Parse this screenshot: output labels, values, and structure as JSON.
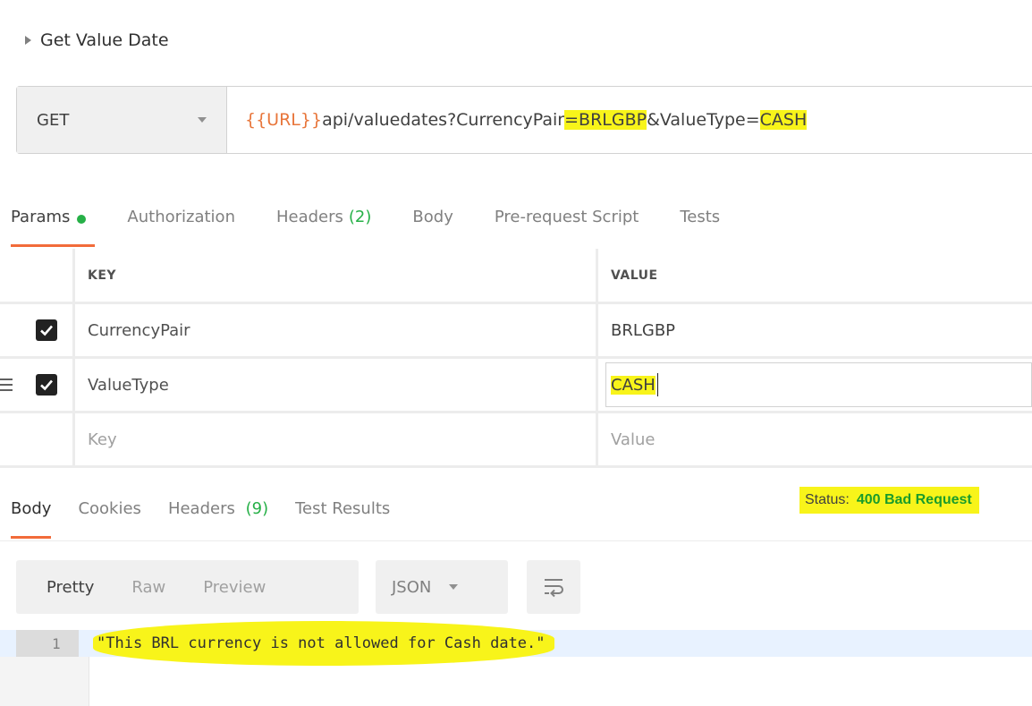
{
  "request": {
    "name": "Get Value Date",
    "method": "GET",
    "url": {
      "variable": "{{URL}}",
      "path": "api/valuedates?CurrencyPair",
      "eq1": "=",
      "value1": "BRLGBP",
      "mid": "&ValueType=",
      "value2": "CASH"
    }
  },
  "request_tabs": [
    {
      "label": "Params"
    },
    {
      "label": "Authorization"
    },
    {
      "label": "Headers",
      "count": "(2)"
    },
    {
      "label": "Body"
    },
    {
      "label": "Pre-request Script"
    },
    {
      "label": "Tests"
    }
  ],
  "params": {
    "header": {
      "key": "KEY",
      "value": "VALUE"
    },
    "rows": [
      {
        "key": "CurrencyPair",
        "value": "BRLGBP",
        "checked": true
      },
      {
        "key": "ValueType",
        "value": "CASH",
        "checked": true
      }
    ],
    "placeholder": {
      "key": "Key",
      "value": "Value"
    }
  },
  "response_tabs": [
    {
      "label": "Body"
    },
    {
      "label": "Cookies"
    },
    {
      "label": "Headers",
      "count": "(9)"
    },
    {
      "label": "Test Results"
    }
  ],
  "status": {
    "label": "Status:",
    "value": "400 Bad Request"
  },
  "viewer": {
    "modes": [
      "Pretty",
      "Raw",
      "Preview"
    ],
    "format": "JSON"
  },
  "response_body": {
    "line_number": "1",
    "text": "\"This BRL currency is not allowed for Cash date.\""
  },
  "colors": {
    "accent": "#f26b3a",
    "success": "#26b047",
    "highlight": "#f8f41a",
    "variable": "#e8763b"
  }
}
